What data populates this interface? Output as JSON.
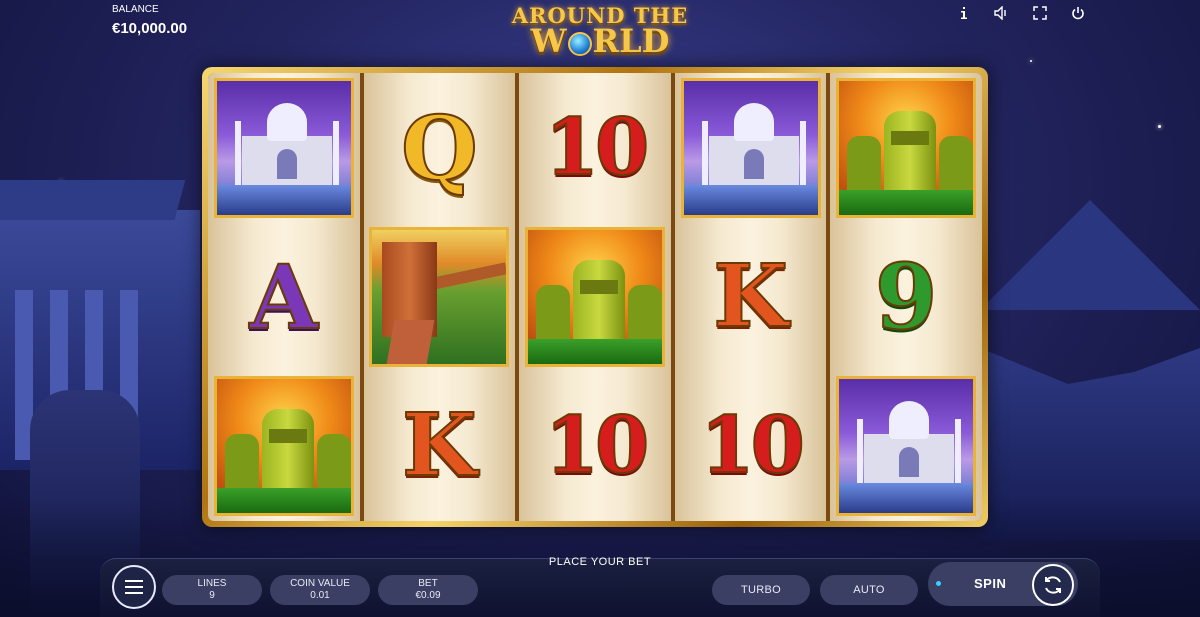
{
  "hud": {
    "balance_label": "BALANCE",
    "balance_value": "€10,000.00",
    "icons": [
      "info-icon",
      "speaker-icon",
      "fullscreen-icon",
      "power-icon"
    ]
  },
  "logo": {
    "line1": "AROUND THE",
    "line2_a": "W",
    "line2_b": "RLD"
  },
  "reels": [
    [
      "taj-mahal",
      "A",
      "moai"
    ],
    [
      "Q",
      "great-wall",
      "K"
    ],
    [
      "10",
      "moai",
      "10"
    ],
    [
      "taj-mahal",
      "K",
      "10"
    ],
    [
      "moai",
      "9",
      "taj-mahal"
    ]
  ],
  "symbols": {
    "Q": "Q",
    "A": "A",
    "K": "K",
    "ten": "10",
    "nine": "9"
  },
  "bottom": {
    "place_bet": "PLACE YOUR BET",
    "lines_label": "LINES",
    "lines_value": "9",
    "coin_label": "COIN VALUE",
    "coin_value": "0.01",
    "bet_label": "BET",
    "bet_value": "€0.09",
    "turbo": "TURBO",
    "auto": "AUTO",
    "spin": "SPIN"
  },
  "colors": {
    "accent_gold": "#f1b928",
    "spin_indicator": "#39d0ff"
  }
}
